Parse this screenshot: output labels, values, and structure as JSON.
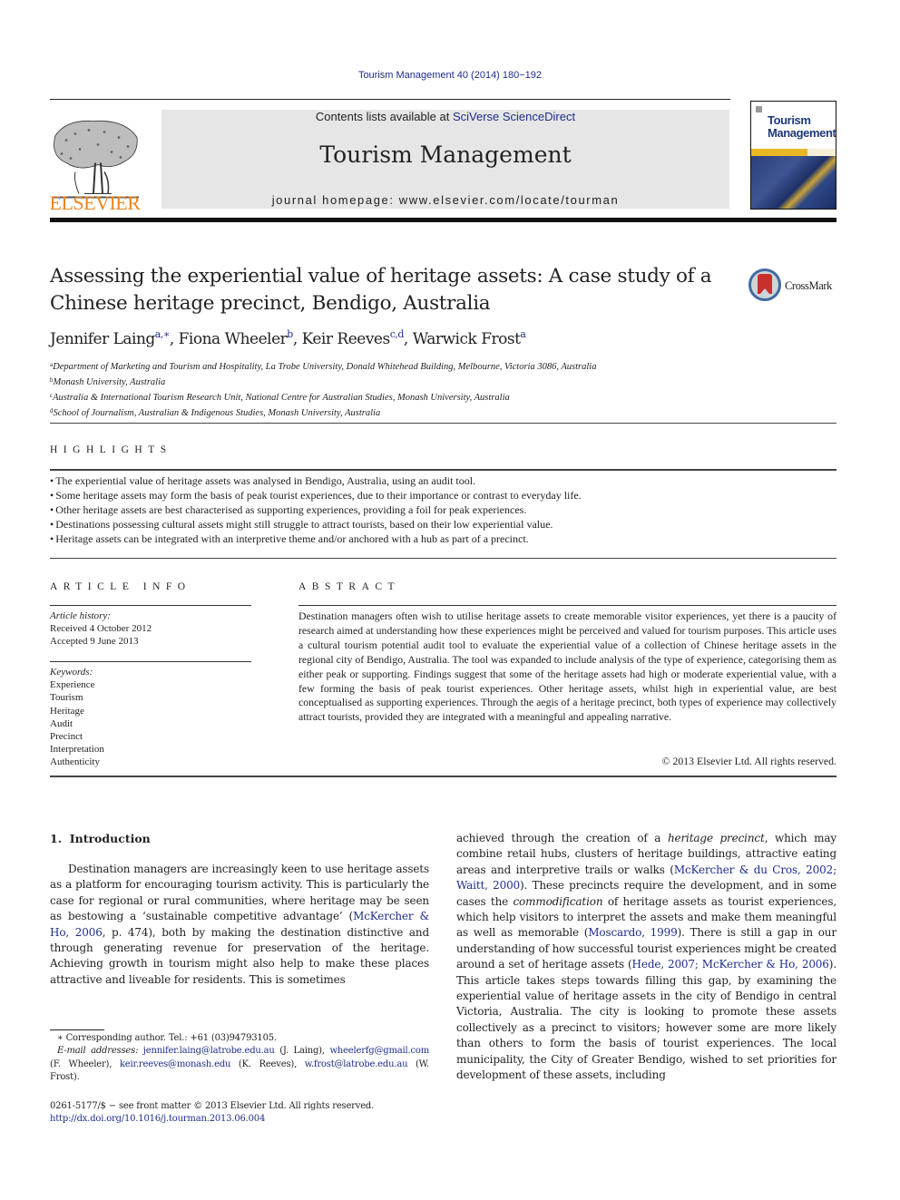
{
  "header": {
    "citation": "Tourism Management 40 (2014) 180−192",
    "contents_prefix": "Contents lists available at ",
    "contents_link": "SciVerse ScienceDirect",
    "journal_title": "Tourism Management",
    "homepage": "journal homepage: www.elsevier.com/locate/tourman",
    "publisher_wordmark": "ELSEVIER",
    "cover_title_line1": "Tourism",
    "cover_title_line2": "Management",
    "brand_color": "#f08519",
    "link_color": "#1f2e8a"
  },
  "article": {
    "title": "Assessing the experiential value of heritage assets: A case study of a Chinese heritage precinct, Bendigo, Australia",
    "crossmark_label": "CrossMark",
    "authors": [
      {
        "name": "Jennifer Laing",
        "sup": "a,∗",
        "sep": ", "
      },
      {
        "name": "Fiona Wheeler",
        "sup": "b",
        "sep": ", "
      },
      {
        "name": "Keir Reeves",
        "sup": "c,d",
        "sep": ", "
      },
      {
        "name": "Warwick Frost",
        "sup": "a",
        "sep": ""
      }
    ],
    "affiliations": [
      {
        "key": "a",
        "text": "Department of Marketing and Tourism and Hospitality, La Trobe University, Donald Whitehead Building, Melbourne, Victoria 3086, Australia"
      },
      {
        "key": "b",
        "text": "Monash University, Australia"
      },
      {
        "key": "c",
        "text": "Australia & International Tourism Research Unit, National Centre for Australian Studies, Monash University, Australia"
      },
      {
        "key": "d",
        "text": "School of Journalism, Australian & Indigenous Studies, Monash University, Australia"
      }
    ]
  },
  "highlights": {
    "heading": "HIGHLIGHTS",
    "items": [
      "The experiential value of heritage assets was analysed in Bendigo, Australia, using an audit tool.",
      "Some heritage assets may form the basis of peak tourist experiences, due to their importance or contrast to everyday life.",
      "Other heritage assets are best characterised as supporting experiences, providing a foil for peak experiences.",
      "Destinations possessing cultural assets might still struggle to attract tourists, based on their low experiential value.",
      "Heritage assets can be integrated with an interpretive theme and/or anchored with a hub as part of a precinct."
    ]
  },
  "article_info": {
    "heading": "ARTICLE INFO",
    "history_label": "Article history:",
    "received": "Received 4 October 2012",
    "accepted": "Accepted 9 June 2013",
    "keywords_label": "Keywords:",
    "keywords": [
      "Experience",
      "Tourism",
      "Heritage",
      "Audit",
      "Precinct",
      "Interpretation",
      "Authenticity"
    ]
  },
  "abstract": {
    "heading": "ABSTRACT",
    "text": "Destination managers often wish to utilise heritage assets to create memorable visitor experiences, yet there is a paucity of research aimed at understanding how these experiences might be perceived and valued for tourism purposes. This article uses a cultural tourism potential audit tool to evaluate the experiential value of a collection of Chinese heritage assets in the regional city of Bendigo, Australia. The tool was expanded to include analysis of the type of experience, categorising them as either peak or supporting. Findings suggest that some of the heritage assets had high or moderate experiential value, with a few forming the basis of peak tourist experiences. Other heritage assets, whilst high in experiential value, are best conceptualised as supporting experiences. Through the aegis of a heritage precinct, both types of experience may collectively attract tourists, provided they are integrated with a meaningful and appealing narrative.",
    "copyright": "© 2013 Elsevier Ltd. All rights reserved."
  },
  "introduction": {
    "heading": "1.  Introduction",
    "left": {
      "t1": "Destination managers are increasingly keen to use heritage assets as a platform for encouraging tourism activity. This is particularly the case for regional or rural communities, where heritage may be seen as bestowing a ‘sustainable competitive advantage’ (",
      "ref1": "McKercher & Ho, 2006",
      "t2": ", p. 474), both by making the destination distinctive and through generating revenue for preservation of the heritage. Achieving growth in tourism might also help to make these places attractive and liveable for residents. This is sometimes"
    },
    "right": {
      "t1": "achieved through the creation of a ",
      "em1": "heritage precinct",
      "t2": ", which may combine retail hubs, clusters of heritage buildings, attractive eating areas and interpretive trails or walks (",
      "ref1": "McKercher & du Cros, 2002; Waitt, 2000",
      "t3": "). These precincts require the development, and in some cases the ",
      "em2": "commodification",
      "t4": " of heritage assets as tourist experiences, which help visitors to interpret the assets and make them meaningful as well as memorable (",
      "ref2": "Moscardo, 1999",
      "t5": "). There is still a gap in our understanding of how successful tourist experiences might be created around a set of heritage assets (",
      "ref3": "Hede, 2007; McKercher & Ho, 2006",
      "t6": "). This article takes steps towards filling this gap, by examining the experiential value of heritage assets in the city of Bendigo in central Victoria, Australia. The city is looking to promote these assets collectively as a precinct to visitors; however some are more likely than others to form the basis of tourist experiences. The local municipality, the City of Greater Bendigo, wished to set priorities for development of these assets, including"
    }
  },
  "footnotes": {
    "corresponding": "∗ Corresponding author. Tel.: +61 (03)94793105.",
    "emails_label": "E-mail addresses:",
    "emails": [
      {
        "email": "jennifer.laing@latrobe.edu.au",
        "who": " (J. Laing), "
      },
      {
        "email": "wheelerfg@gmail.com",
        "who": " (F. Wheeler), "
      },
      {
        "email": "keir.reeves@monash.edu",
        "who": " (K. Reeves), "
      },
      {
        "email": "w.frost@latrobe.edu.au",
        "who": " (W. Frost)."
      }
    ],
    "front_matter": "0261-5177/$ − see front matter © 2013 Elsevier Ltd. All rights reserved.",
    "doi": "http://dx.doi.org/10.1016/j.tourman.2013.06.004"
  }
}
